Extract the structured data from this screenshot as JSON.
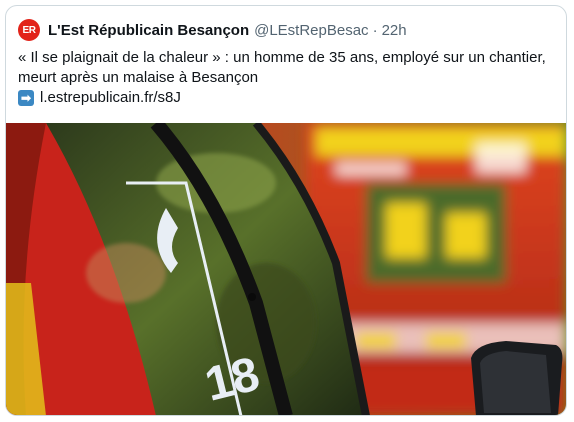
{
  "tweet": {
    "avatar_text": "ER",
    "author_name": "L'Est Républicain Besançon",
    "handle": "@LEstRepBesac",
    "separator": "·",
    "time": "22h",
    "text_line1": "« Il se plaignait de la chaleur » : un homme de 35 ans, employé sur un chantier,",
    "text_line2": "meurt après un malaise à Besançon",
    "arrow_icon": "➡",
    "link": "l.estrepublicain.fr/s8J"
  },
  "image": {
    "door_label": "18",
    "colors": {
      "vehicle_red": "#c8231b",
      "stripe_yellow": "#f2d21b",
      "foliage_green": "#5a7d2a"
    }
  }
}
